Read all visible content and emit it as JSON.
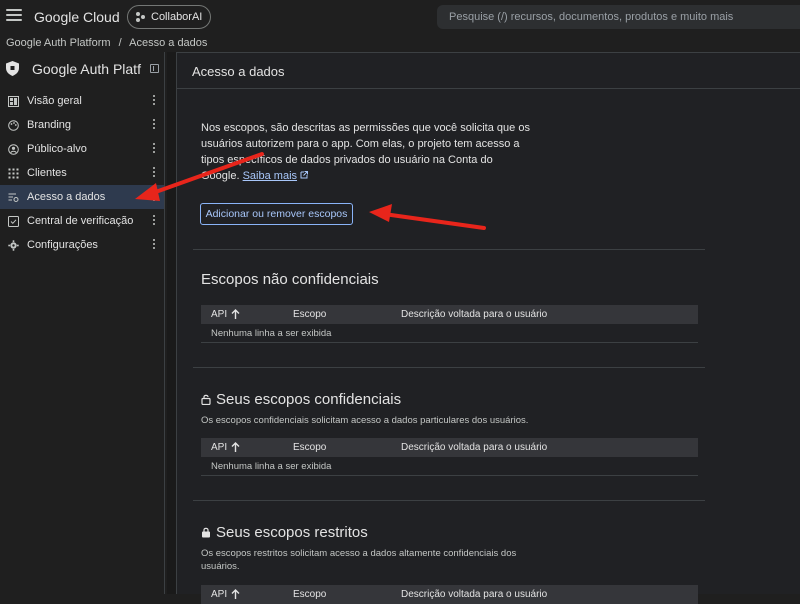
{
  "topbar": {
    "brand": "Google Cloud",
    "project": "CollaborAI",
    "search_placeholder": "Pesquise (/) recursos, documentos, produtos e muito mais"
  },
  "breadcrumb": {
    "root": "Google Auth Platform",
    "separator": "/",
    "current": "Acesso a dados"
  },
  "sidebar": {
    "title": "Google Auth Platf...",
    "items": [
      {
        "label": "Visão geral",
        "icon": "dashboard-icon"
      },
      {
        "label": "Branding",
        "icon": "palette-icon"
      },
      {
        "label": "Público-alvo",
        "icon": "person-icon"
      },
      {
        "label": "Clientes",
        "icon": "grid-icon"
      },
      {
        "label": "Acesso a dados",
        "icon": "data-access-icon",
        "active": true
      },
      {
        "label": "Central de verificação",
        "icon": "verified-icon"
      },
      {
        "label": "Configurações",
        "icon": "gear-icon"
      }
    ]
  },
  "main": {
    "header": "Acesso a dados",
    "intro": "Nos escopos, são descritas as permissões que você solicita que os usuários autorizem para o app. Com elas, o projeto tem acesso a tipos específicos de dados privados do usuário na Conta do Google.",
    "learn_more": "Saiba mais",
    "add_button": "Adicionar ou remover escopos",
    "table_headers": {
      "api": "API",
      "scope": "Escopo",
      "description": "Descrição voltada para o usuário"
    },
    "empty_row": "Nenhuma linha a ser exibida",
    "section1": {
      "title": "Escopos não confidenciais"
    },
    "section2": {
      "title": "Seus escopos confidenciais",
      "desc": "Os escopos confidenciais solicitam acesso a dados particulares dos usuários."
    },
    "section3": {
      "title": "Seus escopos restritos",
      "desc": "Os escopos restritos solicitam acesso a dados altamente confidenciais dos usuários."
    }
  },
  "colors": {
    "accent": "#a8c7fa",
    "annotation_arrow": "#e8251b",
    "active_nav": "#2e3a4e"
  }
}
